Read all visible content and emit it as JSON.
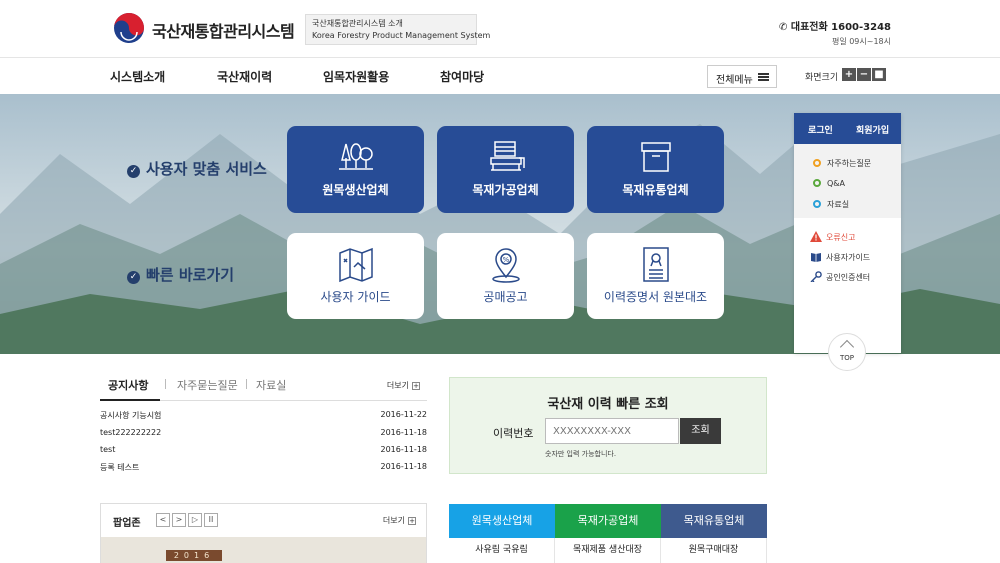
{
  "header": {
    "site_name": "국산재통합관리시스템",
    "intro_line1": "국산재통합관리시스템 소개",
    "intro_line2": "Korea Forestry Product Management System",
    "phone_label": "대표전화 1600-3248",
    "hours": "평일 09시~18시"
  },
  "nav": {
    "items": [
      "시스템소개",
      "국산재이력",
      "임목자원활용",
      "참여마당"
    ],
    "all_menu": "전체메뉴",
    "font_size_label": "화면크기",
    "font_size_buttons": [
      "+",
      "−",
      "■"
    ]
  },
  "hero": {
    "custom_label": "사용자 맞춤 서비스",
    "quick_label": "빠른 바로가기",
    "custom_tiles": [
      {
        "label": "원목생산업체",
        "icon": "trees-icon"
      },
      {
        "label": "목재가공업체",
        "icon": "sawmill-icon"
      },
      {
        "label": "목재유통업체",
        "icon": "box-icon"
      }
    ],
    "quick_tiles": [
      {
        "label": "사용자 가이드",
        "icon": "map-icon"
      },
      {
        "label": "공매공고",
        "icon": "location-pin-icon"
      },
      {
        "label": "이력증명서 원본대조",
        "icon": "certificate-icon"
      }
    ]
  },
  "side": {
    "login": "로그인",
    "signup": "회원가입",
    "links": [
      {
        "label": "자주하는질문",
        "color": "#f0a020"
      },
      {
        "label": "Q&A",
        "color": "#5aa83c"
      },
      {
        "label": "자료실",
        "color": "#2aa0d8"
      }
    ],
    "links2": [
      "오류신고",
      "사용자가이드",
      "공인인증센터"
    ],
    "top": "TOP"
  },
  "notice": {
    "tabs": [
      "공지사항",
      "자주묻는질문",
      "자료실"
    ],
    "more": "더보기",
    "rows": [
      {
        "title": "공시사항 기능시험",
        "date": "2016-11-22"
      },
      {
        "title": "test222222222",
        "date": "2016-11-18"
      },
      {
        "title": "test",
        "date": "2016-11-18"
      },
      {
        "title": "등록 테스트",
        "date": "2016-11-18"
      }
    ]
  },
  "quick_search": {
    "title": "국산재 이력 빠른 조회",
    "label": "이력번호",
    "placeholder": "XXXXXXXX-XXX",
    "button": "조회",
    "note": "숫자만 입력 가능합니다."
  },
  "popup": {
    "title": "팝업존",
    "controls": [
      "<",
      ">",
      "▷",
      "II"
    ],
    "more": "더보기",
    "year": "2016"
  },
  "industry": {
    "tabs": [
      {
        "label": "원목생산업체",
        "color": "#17a2e6",
        "sub": "사유림  국유림"
      },
      {
        "label": "목재가공업체",
        "color": "#1aa24a",
        "sub": "목재제품 생산대장"
      },
      {
        "label": "목재유통업체",
        "color": "#3e5a8e",
        "sub": "원목구매대장"
      }
    ]
  }
}
